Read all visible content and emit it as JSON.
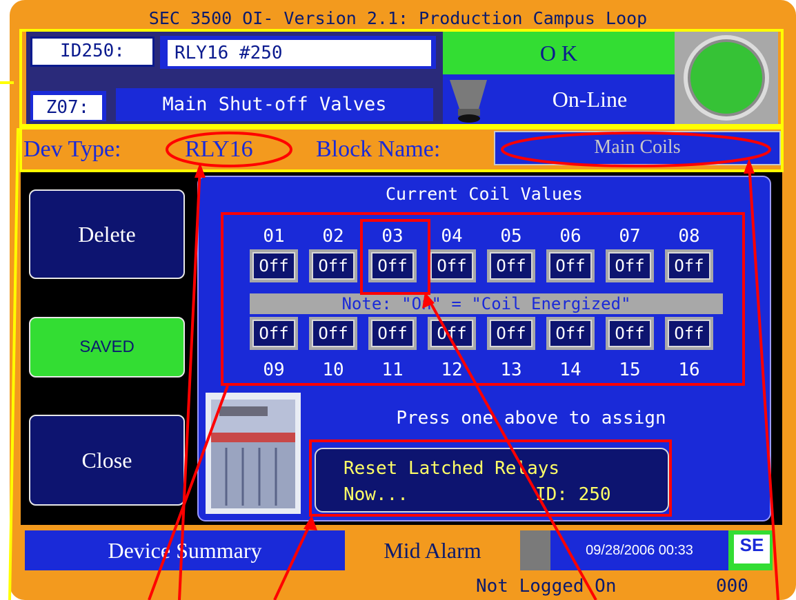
{
  "header": {
    "title": "SEC 3500 OI- Version 2.1: Production Campus Loop",
    "id_label": "ID250:",
    "device_name": "RLY16 #250",
    "zone_label": "Z07:",
    "zone_name": "Main Shut-off Valves",
    "status": "O K",
    "online_status": "On-Line"
  },
  "device_info": {
    "dev_type_label": "Dev Type:",
    "dev_type": "RLY16",
    "block_name_label": "Block Name:",
    "block_name": "Main Coils"
  },
  "sidebar": {
    "delete_label": "Delete",
    "saved_label": "SAVED",
    "close_label": "Close"
  },
  "coils": {
    "title": "Current Coil Values",
    "top_numbers": [
      "01",
      "02",
      "03",
      "04",
      "05",
      "06",
      "07",
      "08"
    ],
    "top_values": [
      "Off",
      "Off",
      "Off",
      "Off",
      "Off",
      "Off",
      "Off",
      "Off"
    ],
    "note": "Note: \"On\" = \"Coil Energized\"",
    "bottom_values": [
      "Off",
      "Off",
      "Off",
      "Off",
      "Off",
      "Off",
      "Off",
      "Off"
    ],
    "bottom_numbers": [
      "09",
      "10",
      "11",
      "12",
      "13",
      "14",
      "15",
      "16"
    ],
    "instruction": "Press one above to assign",
    "reset_line1": "Reset Latched Relays",
    "reset_line2_left": "Now...",
    "reset_line2_right": "ID: 250"
  },
  "footer": {
    "device_summary": "Device Summary",
    "mid_alarm": "Mid Alarm",
    "datetime": "09/28/2006 00:33",
    "logo_text": "SE",
    "login_status": "Not Logged On",
    "counter": "000"
  },
  "colors": {
    "frame_orange": "#f39a1e",
    "ok_green": "#33dd33",
    "panel_blue": "#1a2ad8",
    "annotation_red": "#ff0000",
    "annotation_yellow": "#ffff00"
  }
}
